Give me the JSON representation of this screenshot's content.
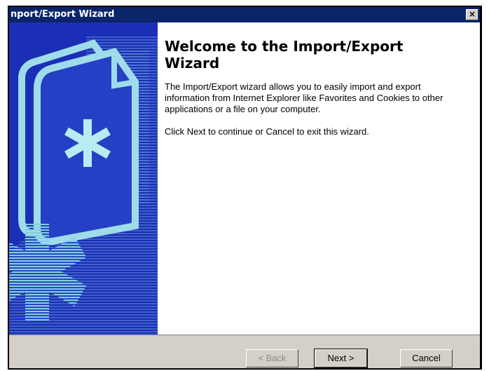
{
  "window": {
    "title": "nport/Export Wizard",
    "close_glyph": "×"
  },
  "content": {
    "heading": "Welcome to the Import/Export Wizard",
    "paragraph1": "The Import/Export wizard allows you to easily import and export information from Internet Explorer like Favorites and Cookies to other applications or a file on your computer.",
    "paragraph2": "Click Next to continue or Cancel to exit this wizard."
  },
  "buttons": {
    "back": "< Back",
    "next": "Next >",
    "cancel": "Cancel"
  },
  "colors": {
    "titlebar": "#0a246a",
    "side_panel": "#1b2fb6",
    "dialog_gray": "#d4d0c8",
    "stripes": "#7fd0e0"
  },
  "icons": {
    "side_illustration": "wizard-document-asterisk-illustration",
    "close": "close-icon"
  }
}
